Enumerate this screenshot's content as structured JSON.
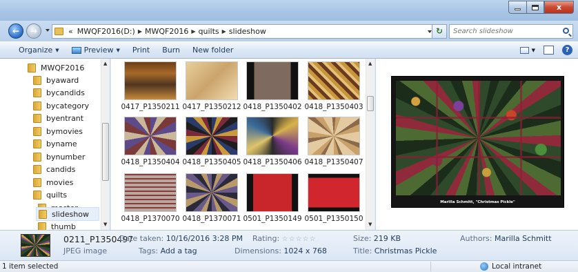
{
  "window": {
    "min_label": "",
    "max_label": "",
    "close_label": "x"
  },
  "address": {
    "overflow": "«",
    "crumbs": [
      "MWQF2016(D:)",
      "MWQF2016",
      "quilts",
      "slideshow"
    ],
    "search_placeholder": "Search slideshow"
  },
  "toolbar": {
    "organize": "Organize",
    "preview": "Preview",
    "print": "Print",
    "burn": "Burn",
    "new_folder": "New folder"
  },
  "tree": {
    "items": [
      {
        "label": "MWQF2016"
      },
      {
        "label": "byaward"
      },
      {
        "label": "bycandids"
      },
      {
        "label": "bycategory"
      },
      {
        "label": "byentrant"
      },
      {
        "label": "bymovies"
      },
      {
        "label": "byname"
      },
      {
        "label": "bynumber"
      },
      {
        "label": "candids"
      },
      {
        "label": "movies"
      },
      {
        "label": "quilts"
      },
      {
        "label": "master"
      },
      {
        "label": "slideshow"
      },
      {
        "label": "thumb"
      }
    ]
  },
  "files": [
    {
      "name": "0417_P1350211"
    },
    {
      "name": "0417_P1350212"
    },
    {
      "name": "0418_P1350402"
    },
    {
      "name": "0418_P1350403"
    },
    {
      "name": "0418_P1350404"
    },
    {
      "name": "0418_P1350405"
    },
    {
      "name": "0418_P1350406"
    },
    {
      "name": "0418_P1350407"
    },
    {
      "name": "0418_P1370070"
    },
    {
      "name": "0418_P1370071"
    },
    {
      "name": "0501_P1350149"
    },
    {
      "name": "0501_P1350150"
    }
  ],
  "preview": {
    "caption": "Marilla Schmitt, \"Christmas Pickle\""
  },
  "details": {
    "filename": "0211_P1350497",
    "filetype": "JPEG image",
    "date_label": "Date taken:",
    "date_value": "10/16/2016 3:28 PM",
    "tags_label": "Tags:",
    "tags_value": "Add a tag",
    "rating_label": "Rating:",
    "rating_stars": "☆☆☆☆☆",
    "dimensions_label": "Dimensions:",
    "dimensions_value": "1024 x 768",
    "size_label": "Size:",
    "size_value": "219 KB",
    "title_label": "Title:",
    "title_value": "Christmas Pickle",
    "authors_label": "Authors:",
    "authors_value": "Marilla Schmitt"
  },
  "status": {
    "selection": "1 item selected",
    "zone": "Local intranet"
  }
}
